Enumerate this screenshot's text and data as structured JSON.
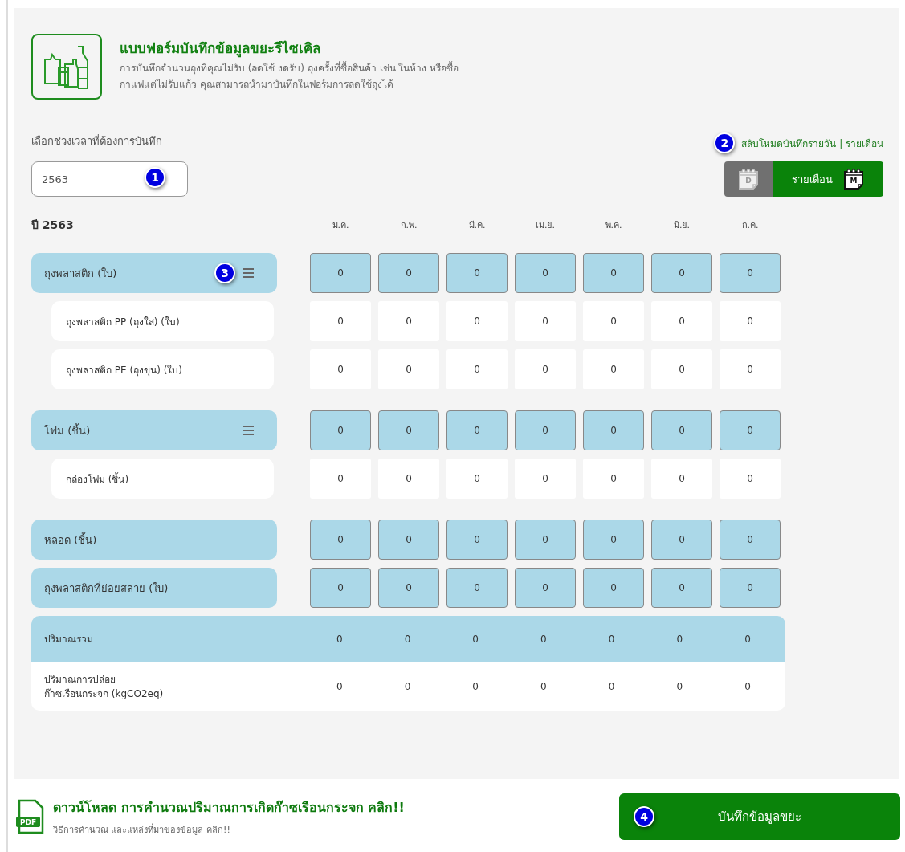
{
  "header": {
    "title": "แบบฟอร์มบันทึกข้อมูลขยะรีไซเคิล",
    "description": "การบันทึกจำนวนถุงที่คุณไม่รับ (ลดใช้ งดรับ) ถุงครั้งที่ซื้อสินค้า เช่น ในห้าง หรือซื้อ\nกาแฟแต่ไม่รับแก้ว คุณสามารถนำมาบันทึกในฟอร์มการลดใช้ถุงได้"
  },
  "period": {
    "label": "เลือกช่วงเวลาที่ต้องการบันทึก",
    "value": "2563",
    "callout": "1"
  },
  "mode": {
    "toggle_link": "สลับโหมดบันทึกรายวัน | รายเดือน",
    "callout": "2",
    "options": [
      {
        "icon_letter": "D",
        "selected": false
      },
      {
        "label": "รายเดือน",
        "icon_letter": "M",
        "selected": true
      }
    ]
  },
  "table": {
    "year_label": "ปี 2563",
    "months": [
      "ม.ค.",
      "ก.พ.",
      "มี.ค.",
      "เม.ย.",
      "พ.ค.",
      "มิ.ย.",
      "ก.ค."
    ],
    "groups": [
      {
        "label": "ถุงพลาสติก (ใบ)",
        "menu": true,
        "callout": "3",
        "values": [
          "0",
          "0",
          "0",
          "0",
          "0",
          "0",
          "0"
        ],
        "children": [
          {
            "label": "ถุงพลาสติก PP (ถุงใส) (ใบ)",
            "values": [
              "0",
              "0",
              "0",
              "0",
              "0",
              "0",
              "0"
            ]
          },
          {
            "label": "ถุงพลาสติก PE (ถุงขุ่น) (ใบ)",
            "values": [
              "0",
              "0",
              "0",
              "0",
              "0",
              "0",
              "0"
            ]
          }
        ]
      },
      {
        "label": "โฟม (ชิ้น)",
        "menu": true,
        "values": [
          "0",
          "0",
          "0",
          "0",
          "0",
          "0",
          "0"
        ],
        "children": [
          {
            "label": "กล่องโฟม (ชิ้น)",
            "values": [
              "0",
              "0",
              "0",
              "0",
              "0",
              "0",
              "0"
            ]
          }
        ]
      },
      {
        "label": "หลอด (ชิ้น)",
        "menu": false,
        "values": [
          "0",
          "0",
          "0",
          "0",
          "0",
          "0",
          "0"
        ]
      },
      {
        "label": "ถุงพลาสติกที่ย่อยสลาย (ใบ)",
        "menu": false,
        "values": [
          "0",
          "0",
          "0",
          "0",
          "0",
          "0",
          "0"
        ]
      }
    ],
    "summary": [
      {
        "kind": "total",
        "label": "ปริมาณรวม",
        "values": [
          "0",
          "0",
          "0",
          "0",
          "0",
          "0",
          "0"
        ]
      },
      {
        "kind": "emission",
        "label": "ปริมาณการปล่อย\nก๊าซเรือนกระจก (kgCO2eq)",
        "values": [
          "0",
          "0",
          "0",
          "0",
          "0",
          "0",
          "0"
        ]
      }
    ]
  },
  "footer": {
    "download_title": "ดาวน์โหลด การคำนวณปริมาณการเกิดก๊าซเรือนกระจก คลิก!!",
    "download_subtitle": "วิธีการคำนวณ และแหล่งที่มาของข้อมูล คลิก!!",
    "pdf_label": "PDF",
    "save_button": "บันทึกข้อมูลขยะ",
    "callout": "4"
  }
}
